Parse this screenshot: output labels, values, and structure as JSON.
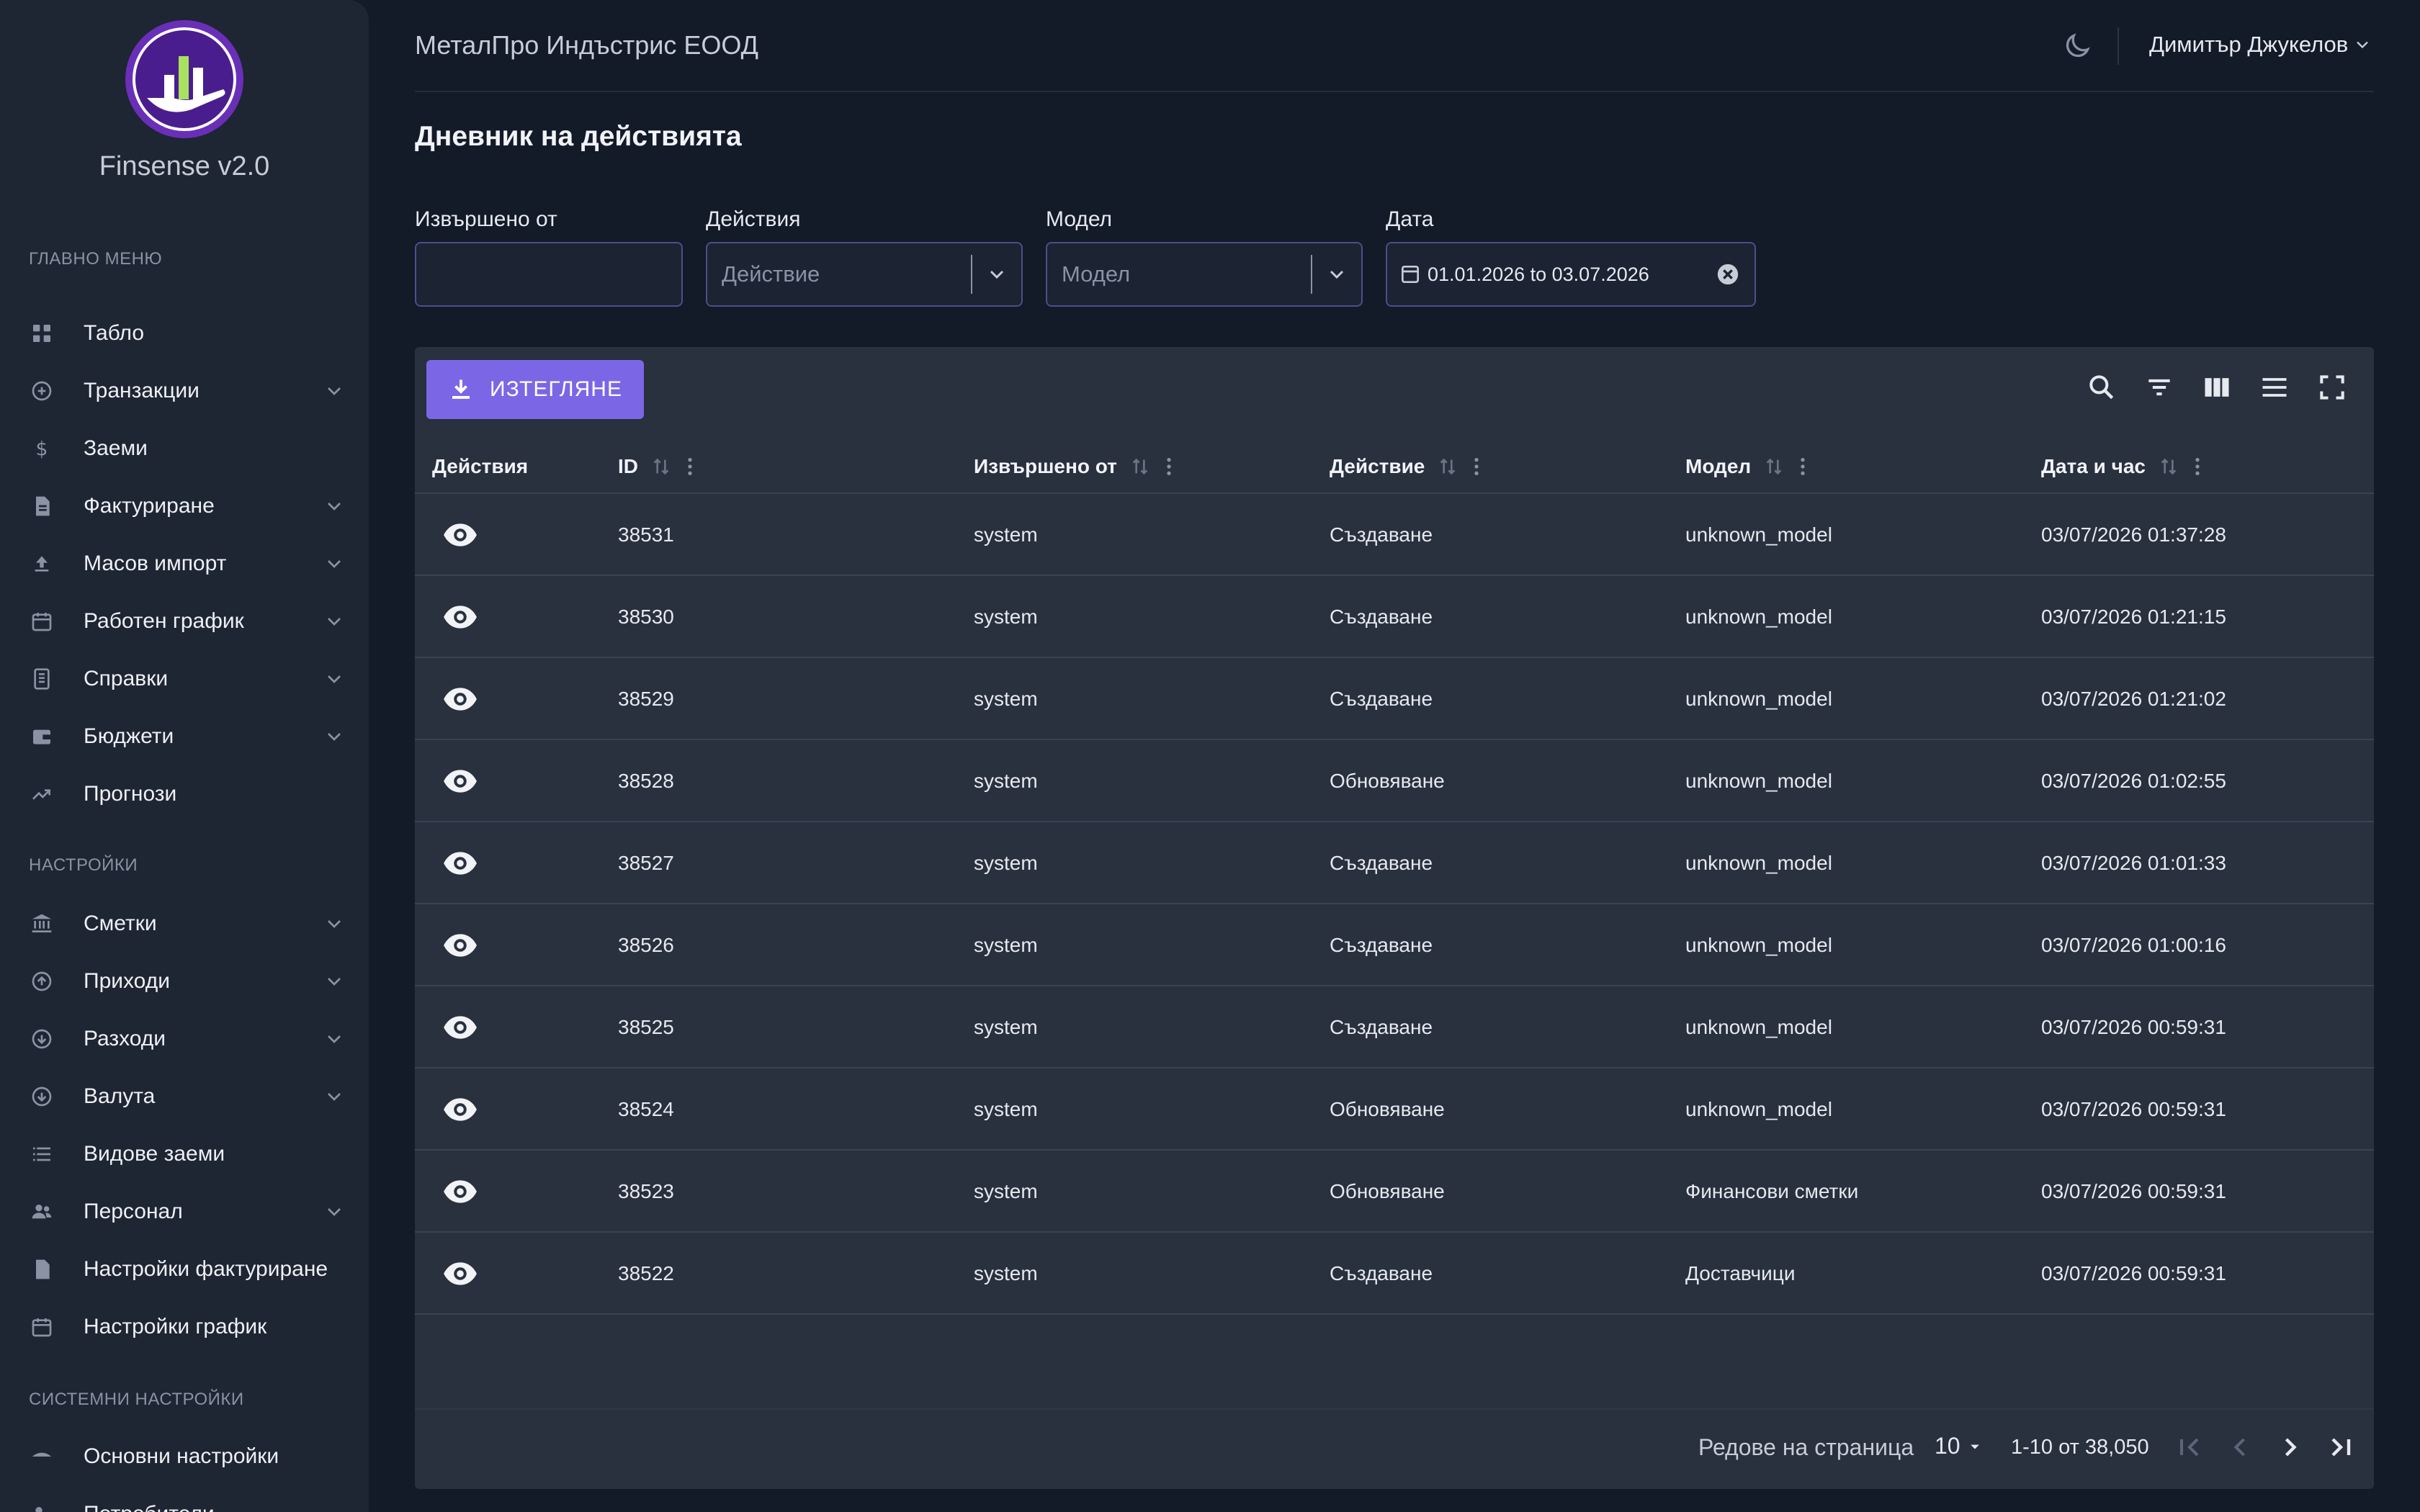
{
  "app": {
    "name": "Finsense v2.0"
  },
  "sidebar": {
    "sections": [
      {
        "title": "ГЛАВНО МЕНЮ"
      },
      {
        "title": "НАСТРОЙКИ"
      },
      {
        "title": "СИСТЕМНИ НАСТРОЙКИ"
      }
    ],
    "items": [
      {
        "label": "Табло",
        "icon": "dashboard-icon"
      },
      {
        "label": "Транзакции",
        "icon": "plus-circle-icon"
      },
      {
        "label": "Заеми",
        "icon": "dollar-icon"
      },
      {
        "label": "Фактуриране",
        "icon": "document-icon"
      },
      {
        "label": "Масов импорт",
        "icon": "upload-icon"
      },
      {
        "label": "Работен график",
        "icon": "calendar-icon"
      },
      {
        "label": "Справки",
        "icon": "report-icon"
      },
      {
        "label": "Бюджети",
        "icon": "wallet-icon"
      },
      {
        "label": "Прогнози",
        "icon": "trending-up-icon"
      },
      {
        "label": "Сметки",
        "icon": "bank-icon"
      },
      {
        "label": "Приходи",
        "icon": "arrow-up-circle-icon"
      },
      {
        "label": "Разходи",
        "icon": "arrow-down-circle-icon"
      },
      {
        "label": "Валута",
        "icon": "arrow-down-circle-icon"
      },
      {
        "label": "Видове заеми",
        "icon": "list-icon"
      },
      {
        "label": "Персонал",
        "icon": "people-icon"
      },
      {
        "label": "Настройки фактуриране",
        "icon": "document-icon"
      },
      {
        "label": "Настройки график",
        "icon": "calendar-icon"
      },
      {
        "label": "Основни настройки",
        "icon": "settings-icon"
      },
      {
        "label": "Потребители",
        "icon": "people-icon"
      }
    ]
  },
  "header": {
    "company": "МеталПро Индъстрис ЕООД",
    "user": "Димитър Джукелов"
  },
  "page": {
    "title": "Дневник на действията"
  },
  "filters": {
    "performed_by": {
      "label": "Извършено от",
      "value": ""
    },
    "actions": {
      "label": "Действия",
      "placeholder": "Действие"
    },
    "model": {
      "label": "Модел",
      "placeholder": "Модел"
    },
    "date": {
      "label": "Дата",
      "value": "01.01.2026 to 03.07.2026"
    }
  },
  "toolbar": {
    "export_label": "ИЗТЕГЛЯНЕ"
  },
  "table": {
    "columns": [
      "Действия",
      "ID",
      "Извършено от",
      "Действие",
      "Модел",
      "Дата и час"
    ],
    "rows": [
      {
        "id": "38531",
        "by": "system",
        "action": "Създаване",
        "model": "unknown_model",
        "datetime": "03/07/2026 01:37:28"
      },
      {
        "id": "38530",
        "by": "system",
        "action": "Създаване",
        "model": "unknown_model",
        "datetime": "03/07/2026 01:21:15"
      },
      {
        "id": "38529",
        "by": "system",
        "action": "Създаване",
        "model": "unknown_model",
        "datetime": "03/07/2026 01:21:02"
      },
      {
        "id": "38528",
        "by": "system",
        "action": "Обновяване",
        "model": "unknown_model",
        "datetime": "03/07/2026 01:02:55"
      },
      {
        "id": "38527",
        "by": "system",
        "action": "Създаване",
        "model": "unknown_model",
        "datetime": "03/07/2026 01:01:33"
      },
      {
        "id": "38526",
        "by": "system",
        "action": "Създаване",
        "model": "unknown_model",
        "datetime": "03/07/2026 01:00:16"
      },
      {
        "id": "38525",
        "by": "system",
        "action": "Създаване",
        "model": "unknown_model",
        "datetime": "03/07/2026 00:59:31"
      },
      {
        "id": "38524",
        "by": "system",
        "action": "Обновяване",
        "model": "unknown_model",
        "datetime": "03/07/2026 00:59:31"
      },
      {
        "id": "38523",
        "by": "system",
        "action": "Обновяване",
        "model": "Финансови сметки",
        "datetime": "03/07/2026 00:59:31"
      },
      {
        "id": "38522",
        "by": "system",
        "action": "Създаване",
        "model": "Доставчици",
        "datetime": "03/07/2026 00:59:31"
      }
    ]
  },
  "pagination": {
    "rows_per_page_label": "Редове на страница",
    "rows_per_page": "10",
    "range": "1-10 от 38,050"
  },
  "colors": {
    "background": "#131a28",
    "sidebar": "#1e2533",
    "card": "#29303e",
    "accent": "#7b67e6"
  }
}
